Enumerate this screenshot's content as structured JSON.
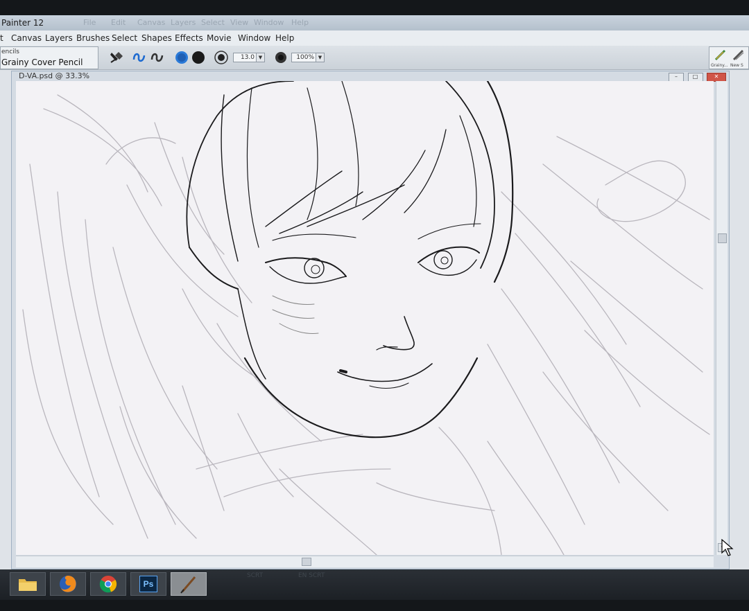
{
  "app": {
    "title": "Painter 12",
    "ghost_menu": [
      "File",
      "Edit",
      "Canvas",
      "Layers",
      "Select",
      "View",
      "Window",
      "Help"
    ]
  },
  "menu": [
    "t",
    "Canvas",
    "Layers",
    "Brushes",
    "Select",
    "Shapes",
    "Effects",
    "Movie",
    "Window",
    "Help"
  ],
  "property_bar": {
    "brush_category": "encils",
    "brush_variant": "Grainy Cover Pencil",
    "size_value": "13.0",
    "opacity_value": "100%",
    "right_palette_labels": [
      "Grainy...",
      "New S"
    ]
  },
  "document": {
    "title": "D-VA.psd @ 33.3%",
    "window_buttons": {
      "minimize": "–",
      "maximize": "□",
      "close": "✕"
    }
  },
  "taskbar": {
    "items": [
      "folder-icon",
      "firefox-icon",
      "chrome-icon",
      "photoshop-icon",
      "painter-icon"
    ],
    "photoshop_label": "Ps",
    "tray_text": [
      "SCRT",
      "EN  SCRT"
    ]
  },
  "colors": {
    "primary_color": "#2a7ad8",
    "secondary_color": "#1a1a1a"
  }
}
